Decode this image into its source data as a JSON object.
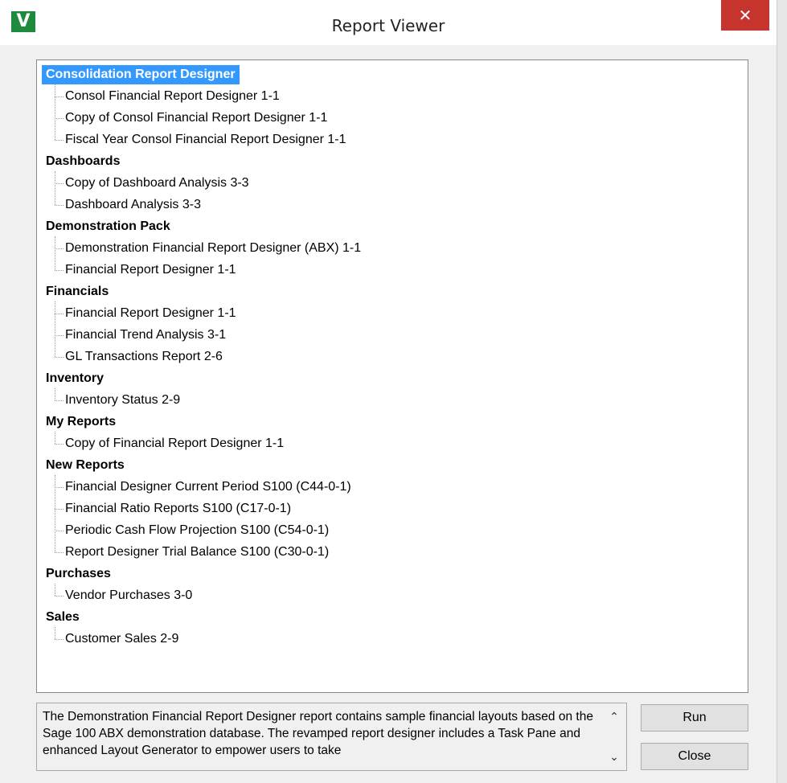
{
  "window": {
    "title": "Report Viewer",
    "icon_letter": "V",
    "close_glyph": "✕"
  },
  "tree": {
    "groups": [
      {
        "label": "Consolidation Report Designer",
        "selected": true,
        "items": [
          "Consol Financial Report Designer 1-1",
          "Copy of Consol Financial Report Designer 1-1",
          "Fiscal Year Consol Financial Report Designer 1-1"
        ]
      },
      {
        "label": "Dashboards",
        "items": [
          "Copy of Dashboard Analysis 3-3",
          "Dashboard Analysis 3-3"
        ]
      },
      {
        "label": "Demonstration Pack",
        "items": [
          "Demonstration Financial Report Designer (ABX) 1-1",
          "Financial Report Designer 1-1"
        ]
      },
      {
        "label": "Financials",
        "items": [
          "Financial Report Designer 1-1",
          "Financial Trend Analysis 3-1",
          "GL Transactions Report 2-6"
        ]
      },
      {
        "label": "Inventory",
        "items": [
          "Inventory Status 2-9"
        ]
      },
      {
        "label": "My Reports",
        "items": [
          "Copy of Financial Report Designer 1-1"
        ]
      },
      {
        "label": "New Reports",
        "items": [
          "Financial Designer Current Period S100 (C44-0-1)",
          "Financial Ratio Reports S100 (C17-0-1)",
          "Periodic Cash Flow Projection S100 (C54-0-1)",
          "Report Designer Trial Balance S100 (C30-0-1)"
        ]
      },
      {
        "label": "Purchases",
        "items": [
          "Vendor Purchases 3-0"
        ]
      },
      {
        "label": "Sales",
        "items": [
          "Customer Sales 2-9"
        ]
      }
    ]
  },
  "description": {
    "text": "The Demonstration Financial Report Designer report contains sample financial layouts based on the Sage 100 ABX demonstration database. The revamped report designer includes a Task Pane and enhanced Layout Generator to empower users to take",
    "scroll_up_glyph": "⌃",
    "scroll_down_glyph": "⌄"
  },
  "buttons": {
    "run_label": "Run",
    "close_label": "Close"
  },
  "colors": {
    "selection": "#3399ff",
    "close_button": "#c7332d",
    "app_icon": "#1e8a3c"
  }
}
